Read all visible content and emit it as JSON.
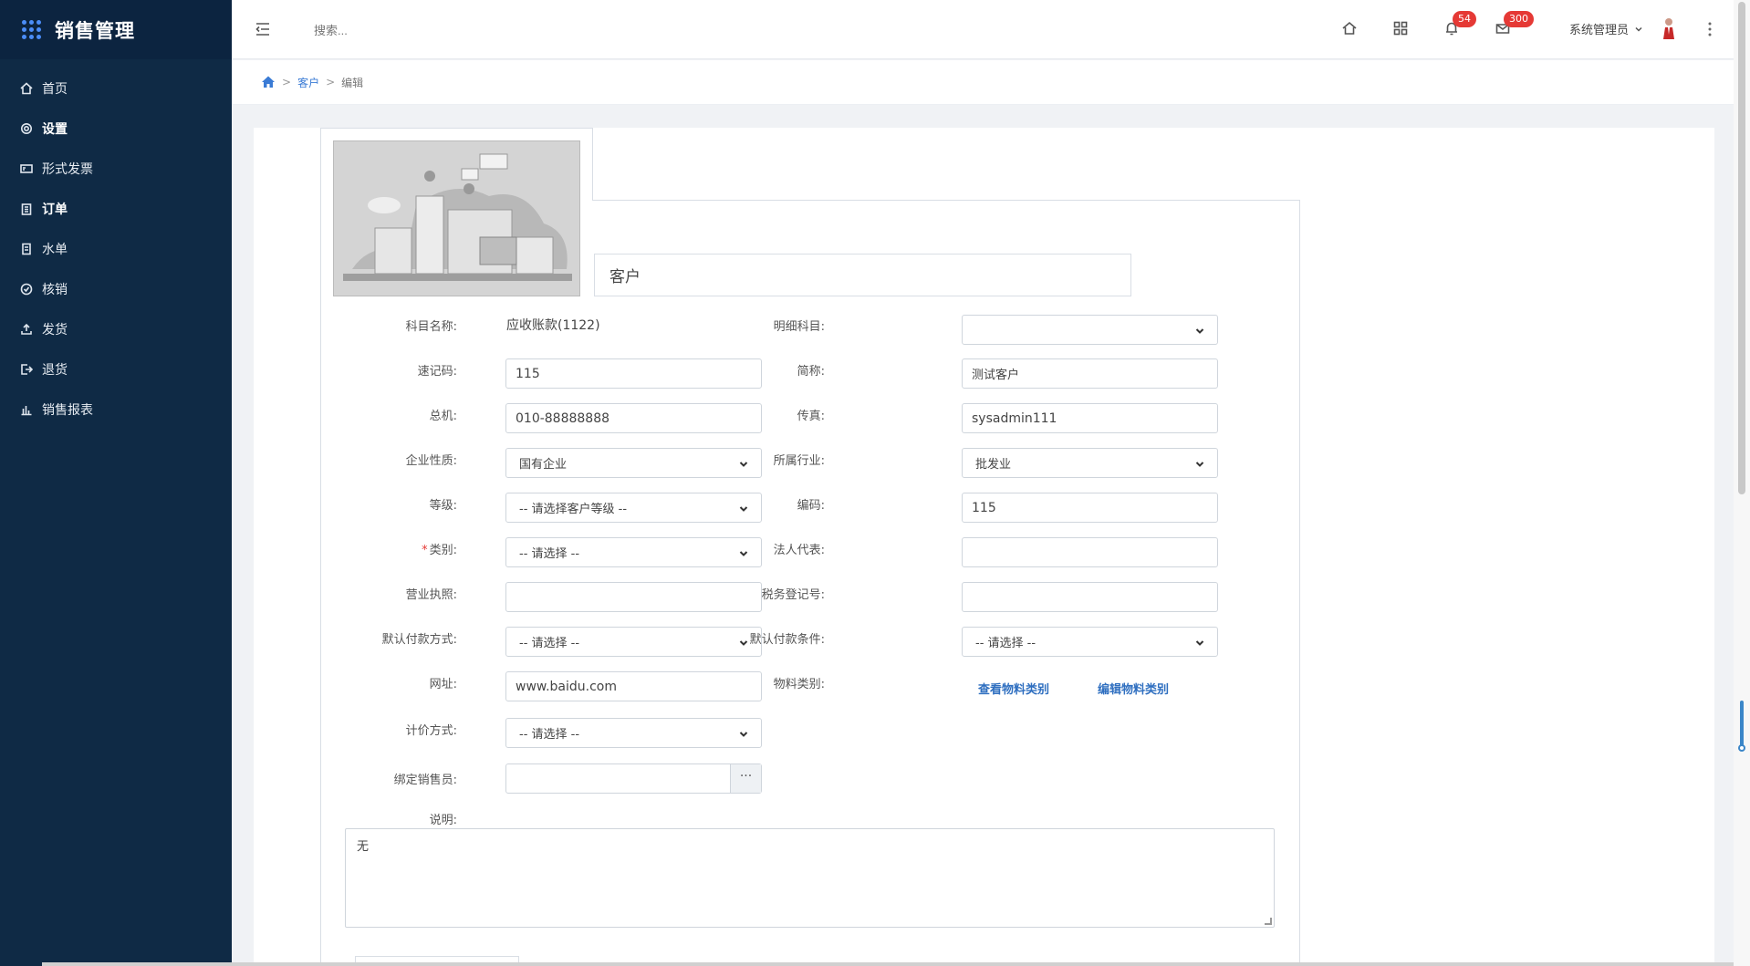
{
  "app": {
    "title": "销售管理"
  },
  "sidebar": {
    "items": [
      {
        "label": "首页",
        "icon": "home-icon",
        "bold": false
      },
      {
        "label": "设置",
        "icon": "gear-icon",
        "bold": true
      },
      {
        "label": "形式发票",
        "icon": "invoice-icon",
        "bold": false
      },
      {
        "label": "订单",
        "icon": "clipboard-icon",
        "bold": true
      },
      {
        "label": "水单",
        "icon": "receipt-icon",
        "bold": false
      },
      {
        "label": "核销",
        "icon": "check-circle-icon",
        "bold": false
      },
      {
        "label": "发货",
        "icon": "upload-icon",
        "bold": false
      },
      {
        "label": "退货",
        "icon": "exit-icon",
        "bold": false
      },
      {
        "label": "销售报表",
        "icon": "bar-chart-icon",
        "bold": false
      }
    ]
  },
  "header": {
    "search_placeholder": "搜索...",
    "notifications_count": "54",
    "messages_count": "300",
    "user_name": "系统管理员"
  },
  "breadcrumb": {
    "crumb1": "客户",
    "crumb2": "编辑"
  },
  "form": {
    "name": "客户",
    "labels": {
      "account_name": "科目名称:",
      "detail_account": "明细科目:",
      "quick_code": "速记码:",
      "short_name": "简称:",
      "phone": "总机:",
      "fax": "传真:",
      "company_type": "企业性质:",
      "industry": "所属行业:",
      "level": "等级:",
      "code": "编码:",
      "category": "类别:",
      "legal_rep": "法人代表:",
      "business_license": "营业执照:",
      "tax_reg": "税务登记号:",
      "payment_method": "默认付款方式:",
      "payment_terms": "默认付款条件:",
      "website": "网址:",
      "material_category": "物料类别:",
      "pricing": "计价方式:",
      "salesperson": "绑定销售员:",
      "remark": "说明:"
    },
    "values": {
      "account_name": "应收账款(1122)",
      "detail_account": "",
      "quick_code": "115",
      "short_name": "测试客户",
      "phone": "010-88888888",
      "fax": "sysadmin111",
      "company_type": "国有企业",
      "industry": "批发业",
      "level": "-- 请选择客户等级 --",
      "code": "115",
      "category": "-- 请选择 --",
      "legal_rep": "",
      "business_license": "",
      "tax_reg": "",
      "payment_method": "-- 请选择 --",
      "payment_terms": "-- 请选择 --",
      "website": "www.baidu.com",
      "pricing": "-- 请选择 --",
      "salesperson": "",
      "remark": "无"
    },
    "links": {
      "view_material": "查看物料类别",
      "edit_material": "编辑物料类别"
    },
    "picker_button": "···"
  }
}
